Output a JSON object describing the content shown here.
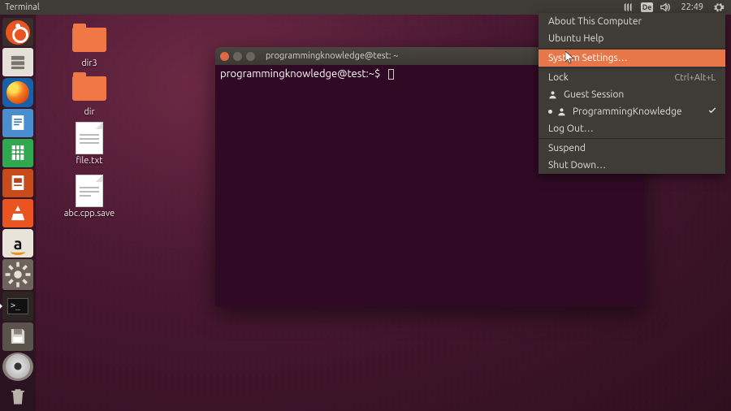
{
  "panel": {
    "app_title": "Terminal",
    "keyboard_indicator": "De",
    "clock": "22:49"
  },
  "desktop": {
    "icons": [
      {
        "name": "dir3"
      },
      {
        "name": "dir"
      },
      {
        "name": "file.txt"
      },
      {
        "name": "abc.cpp.save"
      }
    ]
  },
  "terminal": {
    "title": "programmingknowledge@test: ~",
    "prompt": "programmingknowledge@test:~$"
  },
  "system_menu": {
    "items": {
      "about": "About This Computer",
      "help": "Ubuntu Help",
      "settings": "System Settings…",
      "lock": "Lock",
      "lock_shortcut": "Ctrl+Alt+L",
      "guest": "Guest Session",
      "user": "ProgrammingKnowledge",
      "logout": "Log Out…",
      "suspend": "Suspend",
      "shutdown": "Shut Down…"
    }
  },
  "launcher": {
    "items": {
      "dash": "dash",
      "files": "files",
      "firefox": "firefox",
      "writer": "libreoffice-writer",
      "calc": "libreoffice-calc",
      "impress": "libreoffice-impress",
      "software": "ubuntu-software",
      "amazon": "amazon",
      "settings": "system-settings",
      "terminal": "terminal",
      "disk": "removable-disk",
      "dvd": "dvd-drive",
      "trash": "trash"
    }
  }
}
